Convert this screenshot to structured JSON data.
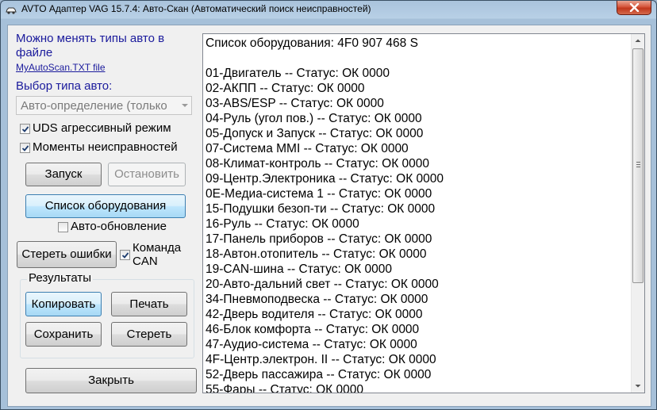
{
  "window": {
    "title": "AVTO Адаптер VAG 15.7.4:  Авто-Скан (Автоматический поиск неисправностей)"
  },
  "left": {
    "info_line1": "Можно менять типы авто в",
    "info_line2": "файле",
    "file_link": "MyAutoScan.TXT file",
    "vehicle_type_label": "Выбор типа авто:",
    "vehicle_type_value": "Авто-определение (только",
    "uds_checkbox_label": "UDS агрессивный режим",
    "uds_checked": true,
    "moments_checkbox_label": "Моменты неисправностей",
    "moments_checked": true,
    "start_button": "Запуск",
    "stop_button": "Остановить",
    "equipment_list_button": "Список оборудования",
    "auto_update_label": "Авто-обновление",
    "auto_update_checked": false,
    "clear_errors_button": "Стереть ошибки",
    "can_command_checked": true,
    "can_command_label_line1": "Команда",
    "can_command_label_line2": "CAN",
    "results_group_title": "Результаты",
    "copy_button": "Копировать",
    "print_button": "Печать",
    "save_button": "Сохранить",
    "erase_button": "Стереть",
    "close_button": "Закрыть"
  },
  "list": {
    "lines": [
      "Список оборудования:  4F0 907 468 S",
      "",
      "01-Двигатель -- Статус: ОК 0000",
      "02-АКПП -- Статус: ОК 0000",
      "03-ABS/ESP -- Статус: ОК 0000",
      "04-Руль (угол пов.) -- Статус: ОК 0000",
      "05-Допуск и Запуск -- Статус: ОК 0000",
      "07-Система MMI -- Статус: ОК 0000",
      "08-Климат-контроль -- Статус: ОК 0000",
      "09-Центр.Электроника -- Статус: ОК 0000",
      "0E-Медиа-система 1 -- Статус: ОК 0000",
      "15-Подушки безоп-ти -- Статус: ОК 0000",
      "16-Руль -- Статус: ОК 0000",
      "17-Панель приборов -- Статус: ОК 0000",
      "18-Автон.отопитель -- Статус: ОК 0000",
      "19-CAN-шина -- Статус: ОК 0000",
      "20-Авто-дальний свет -- Статус: ОК 0000",
      "34-Пневмоподвеска -- Статус: ОК 0000",
      "42-Дверь водителя -- Статус: ОК 0000",
      "46-Блок комфорта -- Статус: ОК 0000",
      "47-Аудио-система -- Статус: ОК 0000",
      "4F-Центр.электрон. II -- Статус: ОК 0000",
      "52-Дверь пассажира -- Статус: ОК 0000",
      "55-Фары -- Статус: ОК 0000"
    ]
  },
  "icons": {
    "app": "car-icon",
    "close": "close-icon"
  }
}
